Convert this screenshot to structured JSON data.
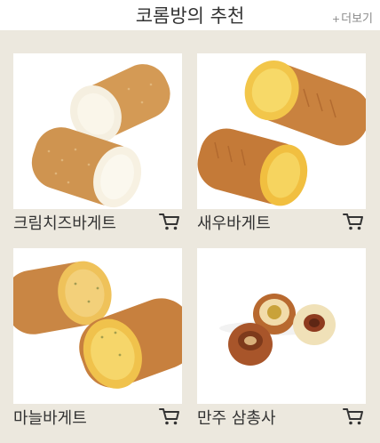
{
  "header": {
    "title": "코롬방의 추천",
    "more_label": "더보기",
    "more_prefix": "+"
  },
  "products": [
    {
      "name": "크림치즈바게트",
      "image": "cream-cheese-baguette-photo",
      "cart_icon": "cart-icon"
    },
    {
      "name": "새우바게트",
      "image": "shrimp-baguette-photo",
      "cart_icon": "cart-icon"
    },
    {
      "name": "마늘바게트",
      "image": "garlic-baguette-photo",
      "cart_icon": "cart-icon"
    },
    {
      "name": "만주 삼총사",
      "image": "manju-trio-photo",
      "cart_icon": "cart-icon"
    }
  ],
  "colors": {
    "panel_bg": "#ece8de",
    "text": "#333333",
    "more_text": "#8a8a8a"
  }
}
